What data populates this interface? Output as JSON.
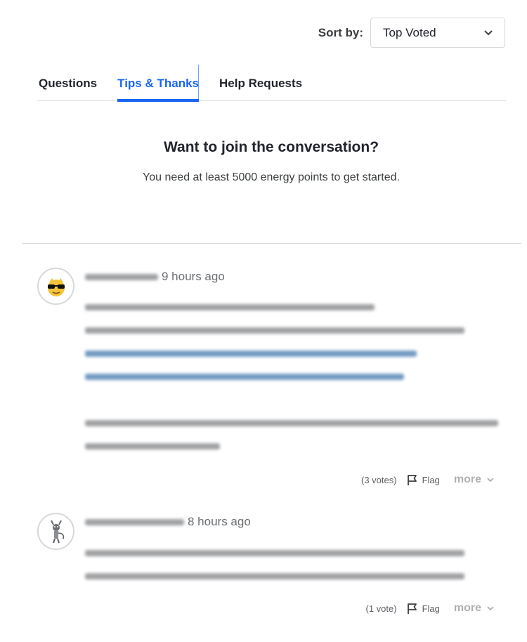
{
  "sort": {
    "label": "Sort by:",
    "selected": "Top Voted"
  },
  "tabs": [
    {
      "label": "Questions",
      "active": false
    },
    {
      "label": "Tips & Thanks",
      "active": true
    },
    {
      "label": "Help Requests",
      "active": false
    }
  ],
  "join": {
    "title": "Want to join the conversation?",
    "subtitle": "You need at least 5000 energy points to get started."
  },
  "posts": [
    {
      "avatar_icon": "sunglasses-avatar-icon",
      "time": "9 hours ago",
      "votes": "(3 votes)",
      "flag_label": "Flag",
      "more_label": "more"
    },
    {
      "avatar_icon": "creature-avatar-icon",
      "time": "8 hours ago",
      "votes": "(1 vote)",
      "flag_label": "Flag",
      "more_label": "more"
    }
  ],
  "colors": {
    "accent": "#1865f2",
    "text": "#21242c",
    "border": "#d6d8da"
  }
}
